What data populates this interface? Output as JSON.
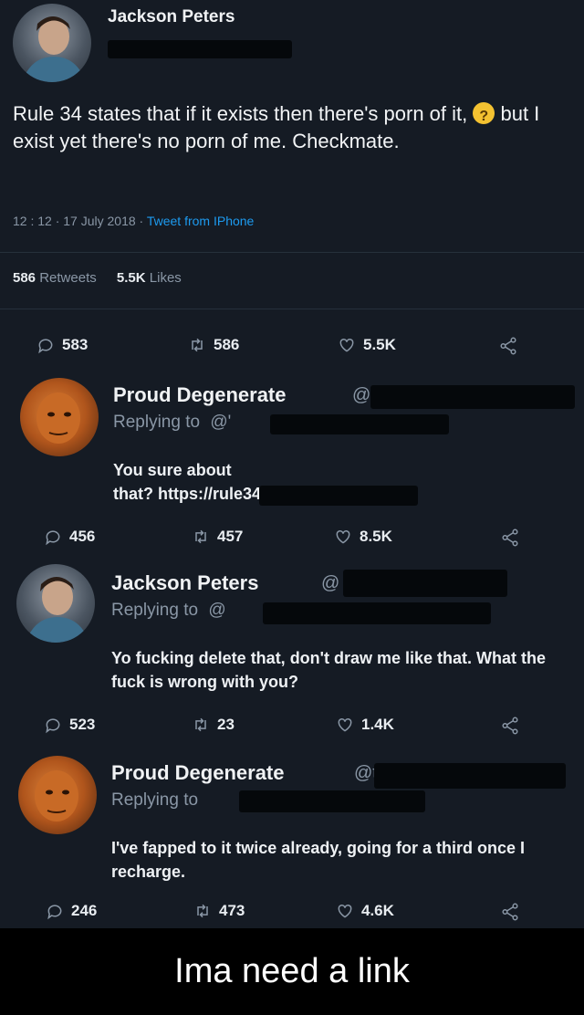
{
  "main_tweet": {
    "author": "Jackson Peters",
    "text_before_emoji": "Rule 34 states that if it exists then there's porn of it,",
    "text_after_emoji": "but I exist yet there's no porn of me. Checkmate.",
    "time": "12 : 12 · 17 July 2018 ·",
    "source": "Tweet from IPhone",
    "retweets_count": "586",
    "retweets_label": "Retweets",
    "likes_count": "5.5K",
    "likes_label": "Likes",
    "actions": {
      "replies": "583",
      "retweets": "586",
      "likes": "5.5K"
    }
  },
  "replies": [
    {
      "author": "Proud Degenerate",
      "handle": "@t",
      "replying_to": "Replying to",
      "replying_handle": "@'",
      "text": "You sure about that? https://rule34",
      "actions": {
        "replies": "456",
        "retweets": "457",
        "likes": "8.5K"
      }
    },
    {
      "author": "Jackson Peters",
      "handle": "@",
      "replying_to": "Replying to",
      "replying_handle": "@",
      "text": "Yo fucking delete that, don't draw me like that. What the fuck is wrong with you?",
      "actions": {
        "replies": "523",
        "retweets": "23",
        "likes": "1.4K"
      }
    },
    {
      "author": "Proud Degenerate",
      "handle": "@t",
      "replying_to": "Replying to",
      "replying_handle": "",
      "text": "I've fapped to it twice already, going for a third once I recharge.",
      "actions": {
        "replies": "246",
        "retweets": "473",
        "likes": "4.6K"
      }
    }
  ],
  "caption": "Ima need a link",
  "icons": {
    "reply": "speech-bubble-icon",
    "retweet": "retweet-arrows-icon",
    "like": "heart-icon",
    "share": "share-nodes-icon"
  },
  "colors": {
    "background": "#151b24",
    "link": "#1d9bf0",
    "muted": "#8a97a6",
    "caption_bg": "#000000"
  }
}
